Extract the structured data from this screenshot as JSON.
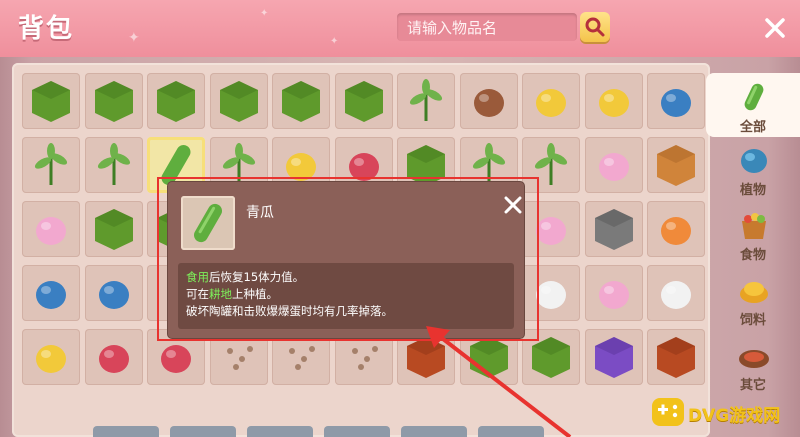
{
  "header": {
    "title": "背包",
    "search_placeholder": "请输入物品名"
  },
  "categories": [
    {
      "label": "全部",
      "icon": "cucumber-icon",
      "active": true
    },
    {
      "label": "植物",
      "icon": "blue-flower-icon",
      "active": false
    },
    {
      "label": "食物",
      "icon": "food-basket-icon",
      "active": false
    },
    {
      "label": "饲料",
      "icon": "feed-icon",
      "active": false
    },
    {
      "label": "其它",
      "icon": "nest-icon",
      "active": false
    }
  ],
  "grid": {
    "selected_item": "cucumber",
    "rows": [
      [
        "leaf-block",
        "leaf-block",
        "yellow-leaf-block",
        "red-leaf-block",
        "leaf-block",
        "leaf-block",
        "grass-tuft",
        "dead-bush",
        "corn-stalk",
        "corn",
        "blue-gourd"
      ],
      [
        "vine",
        "wheat-plant",
        "cucumber",
        "yellow-flowers",
        "lemon",
        "radish",
        "melon-block",
        "seaweed",
        "seaweed",
        "petals",
        "wood-planks"
      ],
      [
        "pink-lily",
        "cactus-block",
        "leaf-plant",
        "",
        "",
        "",
        "",
        "",
        "pink-flower",
        "stone-block",
        "orange-flower"
      ],
      [
        "blue-flower",
        "blue-orchid",
        "",
        "",
        "",
        "",
        "",
        "",
        "white-flower",
        "pink-flower",
        "white-lily"
      ],
      [
        "sunflower",
        "red-flower",
        "red-coral",
        "seeds",
        "seeds",
        "seeds",
        "berry-block",
        "leaf-block",
        "leaf-block",
        "purple-block",
        "lava-block"
      ]
    ]
  },
  "tooltip": {
    "item_name": "青瓜",
    "line1_highlight": "食用",
    "line1_rest": "后恢复15体力值。",
    "line2_prefix": "可在",
    "line2_highlight": "耕地",
    "line2_suffix": "上种植。",
    "line3": "破坏陶罐和击败爆爆蛋时均有几率掉落。"
  },
  "colors": {
    "header": "#f29aa6",
    "panel": "#ecd5cc",
    "slot": "#dfc3b8",
    "tooltip": "#8b6058",
    "highlight_red": "#e8332f",
    "green_text": "#7df05a"
  },
  "watermark": {
    "text": "DVG游戏网"
  }
}
